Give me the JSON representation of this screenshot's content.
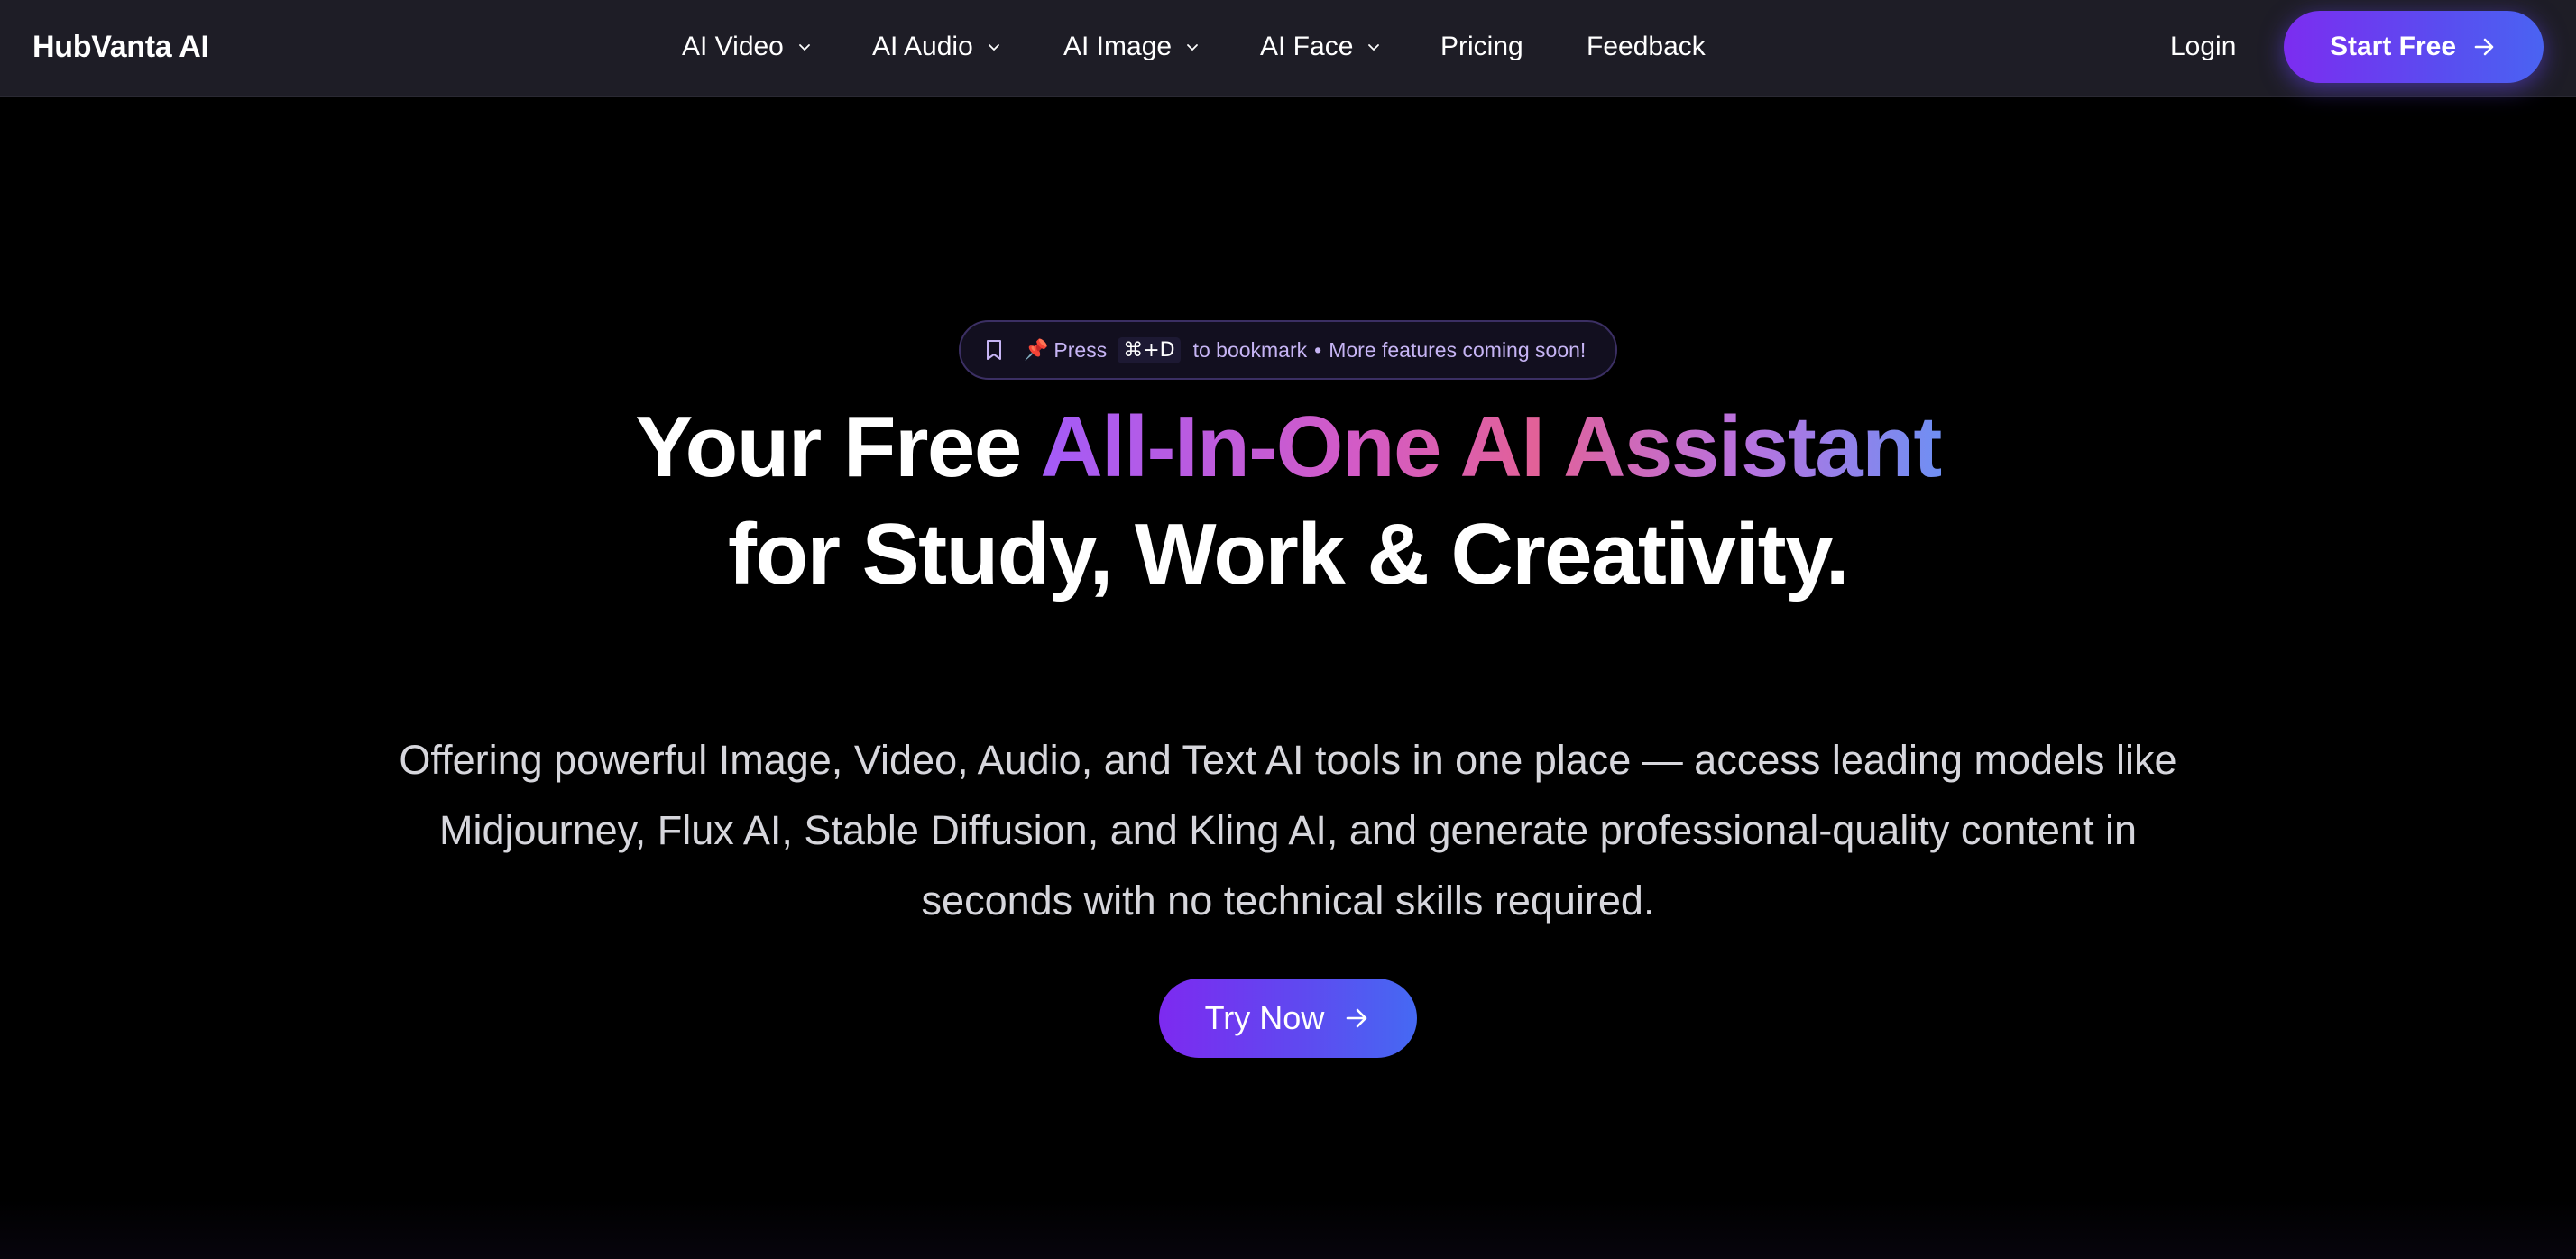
{
  "nav": {
    "brand": "HubVanta AI",
    "items": [
      {
        "label": "AI Video",
        "has_dropdown": true
      },
      {
        "label": "AI Audio",
        "has_dropdown": true
      },
      {
        "label": "AI Image",
        "has_dropdown": true
      },
      {
        "label": "AI Face",
        "has_dropdown": true
      },
      {
        "label": "Pricing",
        "has_dropdown": false
      },
      {
        "label": "Feedback",
        "has_dropdown": false
      }
    ],
    "login_label": "Login",
    "cta_label": "Start Free",
    "cta_icon": "arrow-right-icon",
    "dropdown_icon": "chevron-down-icon"
  },
  "hero": {
    "announcement": {
      "icon": "bookmark-icon",
      "pin": "📌",
      "press": "Press",
      "shortcut": "⌘+D",
      "bookmark_text": "to bookmark",
      "separator": "•",
      "coming_soon": "More features coming soon!"
    },
    "headline_line1_plain": "Your Free",
    "headline_line1_gradient": "All-In-One AI Assistant",
    "headline_line2": "for Study, Work & Creativity.",
    "description": "Offering powerful Image, Video, Audio, and Text AI tools in one place — access leading models like Midjourney, Flux AI, Stable Diffusion, and Kling AI, and generate professional-quality content in seconds with no technical skills required.",
    "cta_label": "Try Now",
    "cta_icon": "arrow-right-icon"
  },
  "colors": {
    "nav_background": "#1e1d26",
    "page_background": "#000000",
    "button_gradient_start": "#7c2df0",
    "button_gradient_end": "#4a63f2",
    "headline_gradient": [
      "#a35bf8",
      "#d35bc6",
      "#e26198",
      "#b972df",
      "#6f8ff3"
    ],
    "pill_text": "#c6b4f4"
  }
}
